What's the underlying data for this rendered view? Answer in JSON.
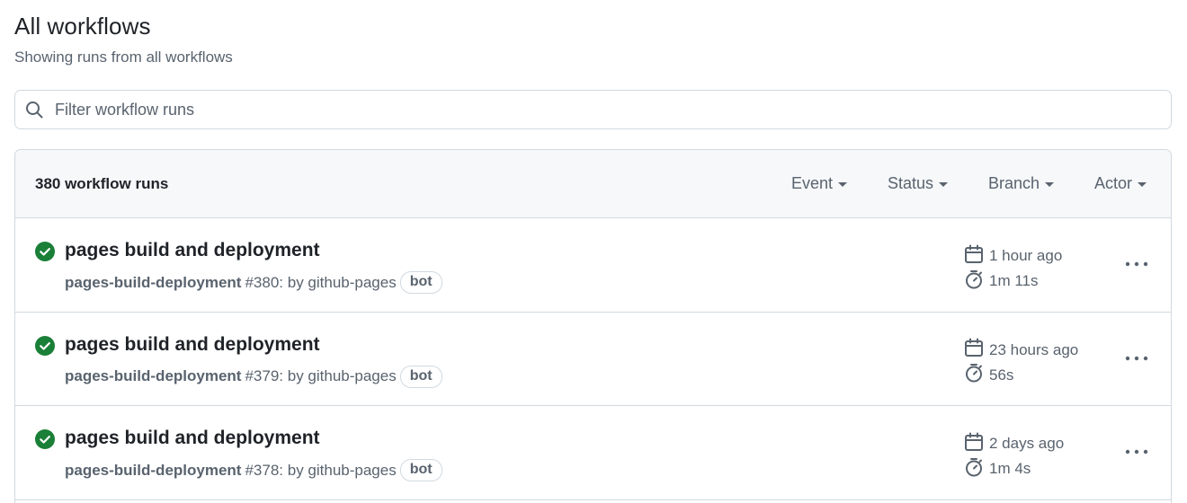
{
  "page": {
    "title": "All workflows",
    "subtitle": "Showing runs from all workflows"
  },
  "filter": {
    "placeholder": "Filter workflow runs",
    "value": ""
  },
  "runs_header": {
    "count_label": "380 workflow runs",
    "filters": [
      {
        "label": "Event"
      },
      {
        "label": "Status"
      },
      {
        "label": "Branch"
      },
      {
        "label": "Actor"
      }
    ]
  },
  "runs": [
    {
      "status": "success",
      "title": "pages build and deployment",
      "workflow": "pages-build-deployment",
      "run_ref": "#380: by github-pages",
      "badge": "bot",
      "when": "1 hour ago",
      "duration": "1m 11s"
    },
    {
      "status": "success",
      "title": "pages build and deployment",
      "workflow": "pages-build-deployment",
      "run_ref": "#379: by github-pages",
      "badge": "bot",
      "when": "23 hours ago",
      "duration": "56s"
    },
    {
      "status": "success",
      "title": "pages build and deployment",
      "workflow": "pages-build-deployment",
      "run_ref": "#378: by github-pages",
      "badge": "bot",
      "when": "2 days ago",
      "duration": "1m 4s"
    }
  ],
  "icons": {
    "status": "check-circle-fill-icon",
    "calendar": "calendar-icon",
    "duration": "stopwatch-icon",
    "more": "kebab-horizontal-icon",
    "search": "search-icon"
  },
  "colors": {
    "success": "#1a7f37",
    "muted": "#59636e",
    "border": "#d1d9e0",
    "header_bg": "#f6f8fa"
  }
}
